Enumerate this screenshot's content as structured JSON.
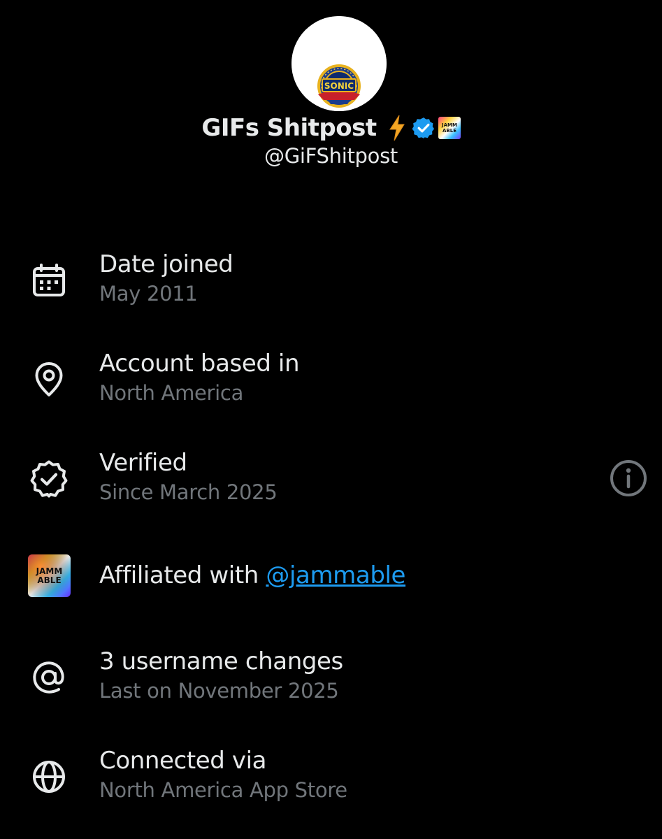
{
  "profile": {
    "avatar_text": "SONIC",
    "display_name": "GIFs Shitpost",
    "handle": "@GiFShitpost",
    "badges": [
      "lightning-icon",
      "verified-badge-icon",
      "jammable-affiliate-badge"
    ],
    "verified_color": "#1d9bf0",
    "lightning_color": "#f4a623"
  },
  "about": {
    "date_joined": {
      "title": "Date joined",
      "value": "May 2011",
      "icon": "calendar-icon"
    },
    "account_based_in": {
      "title": "Account based in",
      "value": "North America",
      "icon": "location-pin-icon"
    },
    "verified": {
      "title": "Verified",
      "value": "Since March 2025",
      "icon": "verified-badge-outline-icon",
      "info_icon": "info-icon"
    },
    "affiliated": {
      "label": "Affiliated with",
      "link": "@jammable",
      "logo_text_line1": "JAMM",
      "logo_text_line2": "ABLE",
      "icon": "jammable-logo"
    },
    "username_changes": {
      "title": "3 username changes",
      "value": "Last on November 2025",
      "icon": "at-sign-icon"
    },
    "connected_via": {
      "title": "Connected via",
      "value": "North America App Store",
      "icon": "globe-icon"
    }
  },
  "colors": {
    "background": "#000000",
    "primary_text": "#e7e9ea",
    "secondary_text": "#71767b",
    "link": "#1d9bf0"
  }
}
